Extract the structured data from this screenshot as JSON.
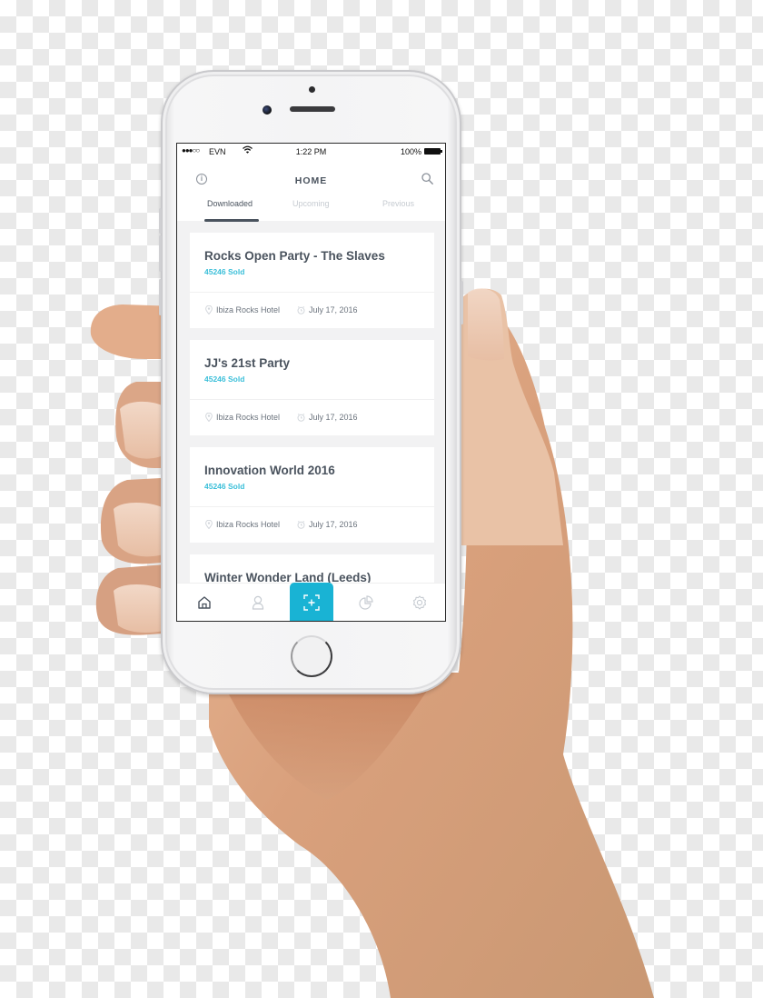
{
  "colors": {
    "accent": "#19b3d4",
    "sold_text": "#3bbfd9",
    "title_text": "#4a535e",
    "inactive_tab": "#c6cbd1",
    "screen_bg": "#f2f2f3"
  },
  "status_bar": {
    "signal": "●●●○○",
    "carrier": "EVN",
    "wifi_icon": "wifi-icon",
    "time": "1:22 PM",
    "battery_percent": "100%",
    "battery_icon": "battery-full-icon"
  },
  "nav": {
    "left_icon": "info-icon",
    "info_glyph": "i",
    "title": "HOME",
    "right_icon": "search-icon"
  },
  "tabs": [
    {
      "label": "Downloaded",
      "active": true
    },
    {
      "label": "Upcoming",
      "active": false
    },
    {
      "label": "Previous",
      "active": false
    }
  ],
  "events": [
    {
      "title": "Rocks Open Party - The Slaves",
      "sold": "45246 Sold",
      "location": "Ibiza Rocks Hotel",
      "date": "July 17, 2016"
    },
    {
      "title": "JJ's 21st Party",
      "sold": "45246 Sold",
      "location": "Ibiza Rocks Hotel",
      "date": "July 17, 2016"
    },
    {
      "title": "Innovation World 2016",
      "sold": "45246 Sold",
      "location": "Ibiza Rocks Hotel",
      "date": "July 17, 2016"
    },
    {
      "title": "Winter Wonder Land (Leeds)",
      "sold": "",
      "location": "",
      "date": ""
    }
  ],
  "bottom_tabs": [
    {
      "icon": "home-icon",
      "active": true
    },
    {
      "icon": "user-icon",
      "active": false
    },
    {
      "icon": "scan-add-icon",
      "active": false,
      "highlighted": true
    },
    {
      "icon": "pie-chart-icon",
      "active": false
    },
    {
      "icon": "settings-gear-icon",
      "active": false
    }
  ]
}
